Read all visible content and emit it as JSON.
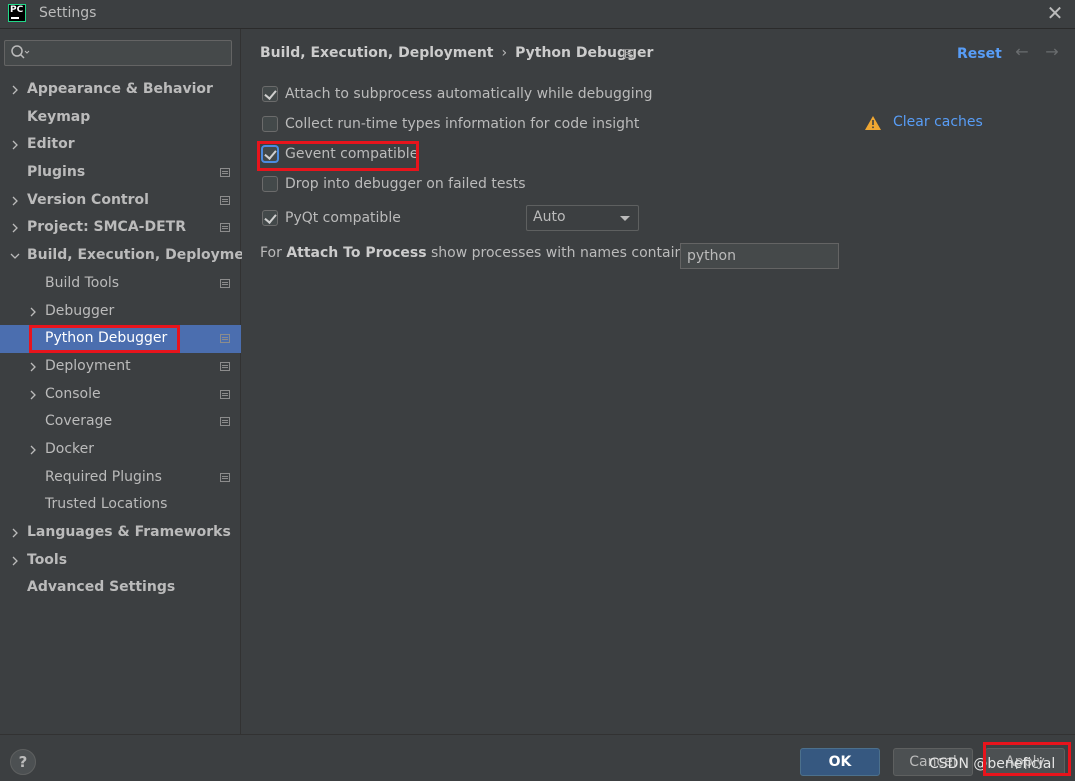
{
  "window": {
    "title": "Settings",
    "logo_text": "PC"
  },
  "search": {
    "placeholder": "",
    "value": ""
  },
  "sidebar": {
    "items": [
      {
        "label": "Appearance & Behavior",
        "bold": true,
        "chevron": "right",
        "indent": 0,
        "project_icon": false,
        "selected": false
      },
      {
        "label": "Keymap",
        "bold": true,
        "chevron": "none",
        "indent": 0,
        "project_icon": false,
        "selected": false
      },
      {
        "label": "Editor",
        "bold": true,
        "chevron": "right",
        "indent": 0,
        "project_icon": false,
        "selected": false
      },
      {
        "label": "Plugins",
        "bold": true,
        "chevron": "none",
        "indent": 0,
        "project_icon": true,
        "selected": false
      },
      {
        "label": "Version Control",
        "bold": true,
        "chevron": "right",
        "indent": 0,
        "project_icon": true,
        "selected": false
      },
      {
        "label": "Project: SMCA-DETR",
        "bold": true,
        "chevron": "right",
        "indent": 0,
        "project_icon": true,
        "selected": false
      },
      {
        "label": "Build, Execution, Deployment",
        "bold": true,
        "chevron": "down",
        "indent": 0,
        "project_icon": false,
        "selected": false
      },
      {
        "label": "Build Tools",
        "bold": false,
        "chevron": "none",
        "indent": 1,
        "project_icon": true,
        "selected": false
      },
      {
        "label": "Debugger",
        "bold": false,
        "chevron": "right",
        "indent": 1,
        "project_icon": false,
        "selected": false
      },
      {
        "label": "Python Debugger",
        "bold": false,
        "chevron": "none",
        "indent": 1,
        "project_icon": true,
        "selected": true
      },
      {
        "label": "Deployment",
        "bold": false,
        "chevron": "right",
        "indent": 1,
        "project_icon": true,
        "selected": false
      },
      {
        "label": "Console",
        "bold": false,
        "chevron": "right",
        "indent": 1,
        "project_icon": true,
        "selected": false
      },
      {
        "label": "Coverage",
        "bold": false,
        "chevron": "none",
        "indent": 1,
        "project_icon": true,
        "selected": false
      },
      {
        "label": "Docker",
        "bold": false,
        "chevron": "right",
        "indent": 1,
        "project_icon": false,
        "selected": false
      },
      {
        "label": "Required Plugins",
        "bold": false,
        "chevron": "none",
        "indent": 1,
        "project_icon": true,
        "selected": false
      },
      {
        "label": "Trusted Locations",
        "bold": false,
        "chevron": "none",
        "indent": 1,
        "project_icon": false,
        "selected": false
      },
      {
        "label": "Languages & Frameworks",
        "bold": true,
        "chevron": "right",
        "indent": 0,
        "project_icon": false,
        "selected": false
      },
      {
        "label": "Tools",
        "bold": true,
        "chevron": "right",
        "indent": 0,
        "project_icon": false,
        "selected": false
      },
      {
        "label": "Advanced Settings",
        "bold": true,
        "chevron": "none",
        "indent": 0,
        "project_icon": false,
        "selected": false
      }
    ]
  },
  "header": {
    "crumb_parent": "Build, Execution, Deployment",
    "crumb_separator": "›",
    "crumb_current": "Python Debugger",
    "reset_label": "Reset"
  },
  "options": {
    "attach_subprocess": {
      "label": "Attach to subprocess automatically while debugging",
      "checked": true
    },
    "collect_types": {
      "label": "Collect run-time types information for code insight",
      "checked": false
    },
    "gevent": {
      "label": "Gevent compatible",
      "checked": true
    },
    "drop_debugger": {
      "label": "Drop into debugger on failed tests",
      "checked": false
    },
    "pyqt": {
      "label": "PyQt compatible",
      "checked": true
    }
  },
  "clear_caches_label": "Clear caches",
  "pyqt_combo": {
    "value": "Auto"
  },
  "attach_to_process": {
    "prefix": "For ",
    "bold": "Attach To Process",
    "suffix": " show processes with names containing:",
    "value": "python"
  },
  "footer": {
    "help_label": "?",
    "ok_label": "OK",
    "cancel_label": "Cancel",
    "apply_label": "Apply",
    "watermark": "CSDN @beneficial"
  },
  "colors": {
    "background": "#3c3f41",
    "selection": "#4b6eaf",
    "link": "#589df6",
    "highlight": "#e8141c",
    "warning": "#f0a732"
  }
}
